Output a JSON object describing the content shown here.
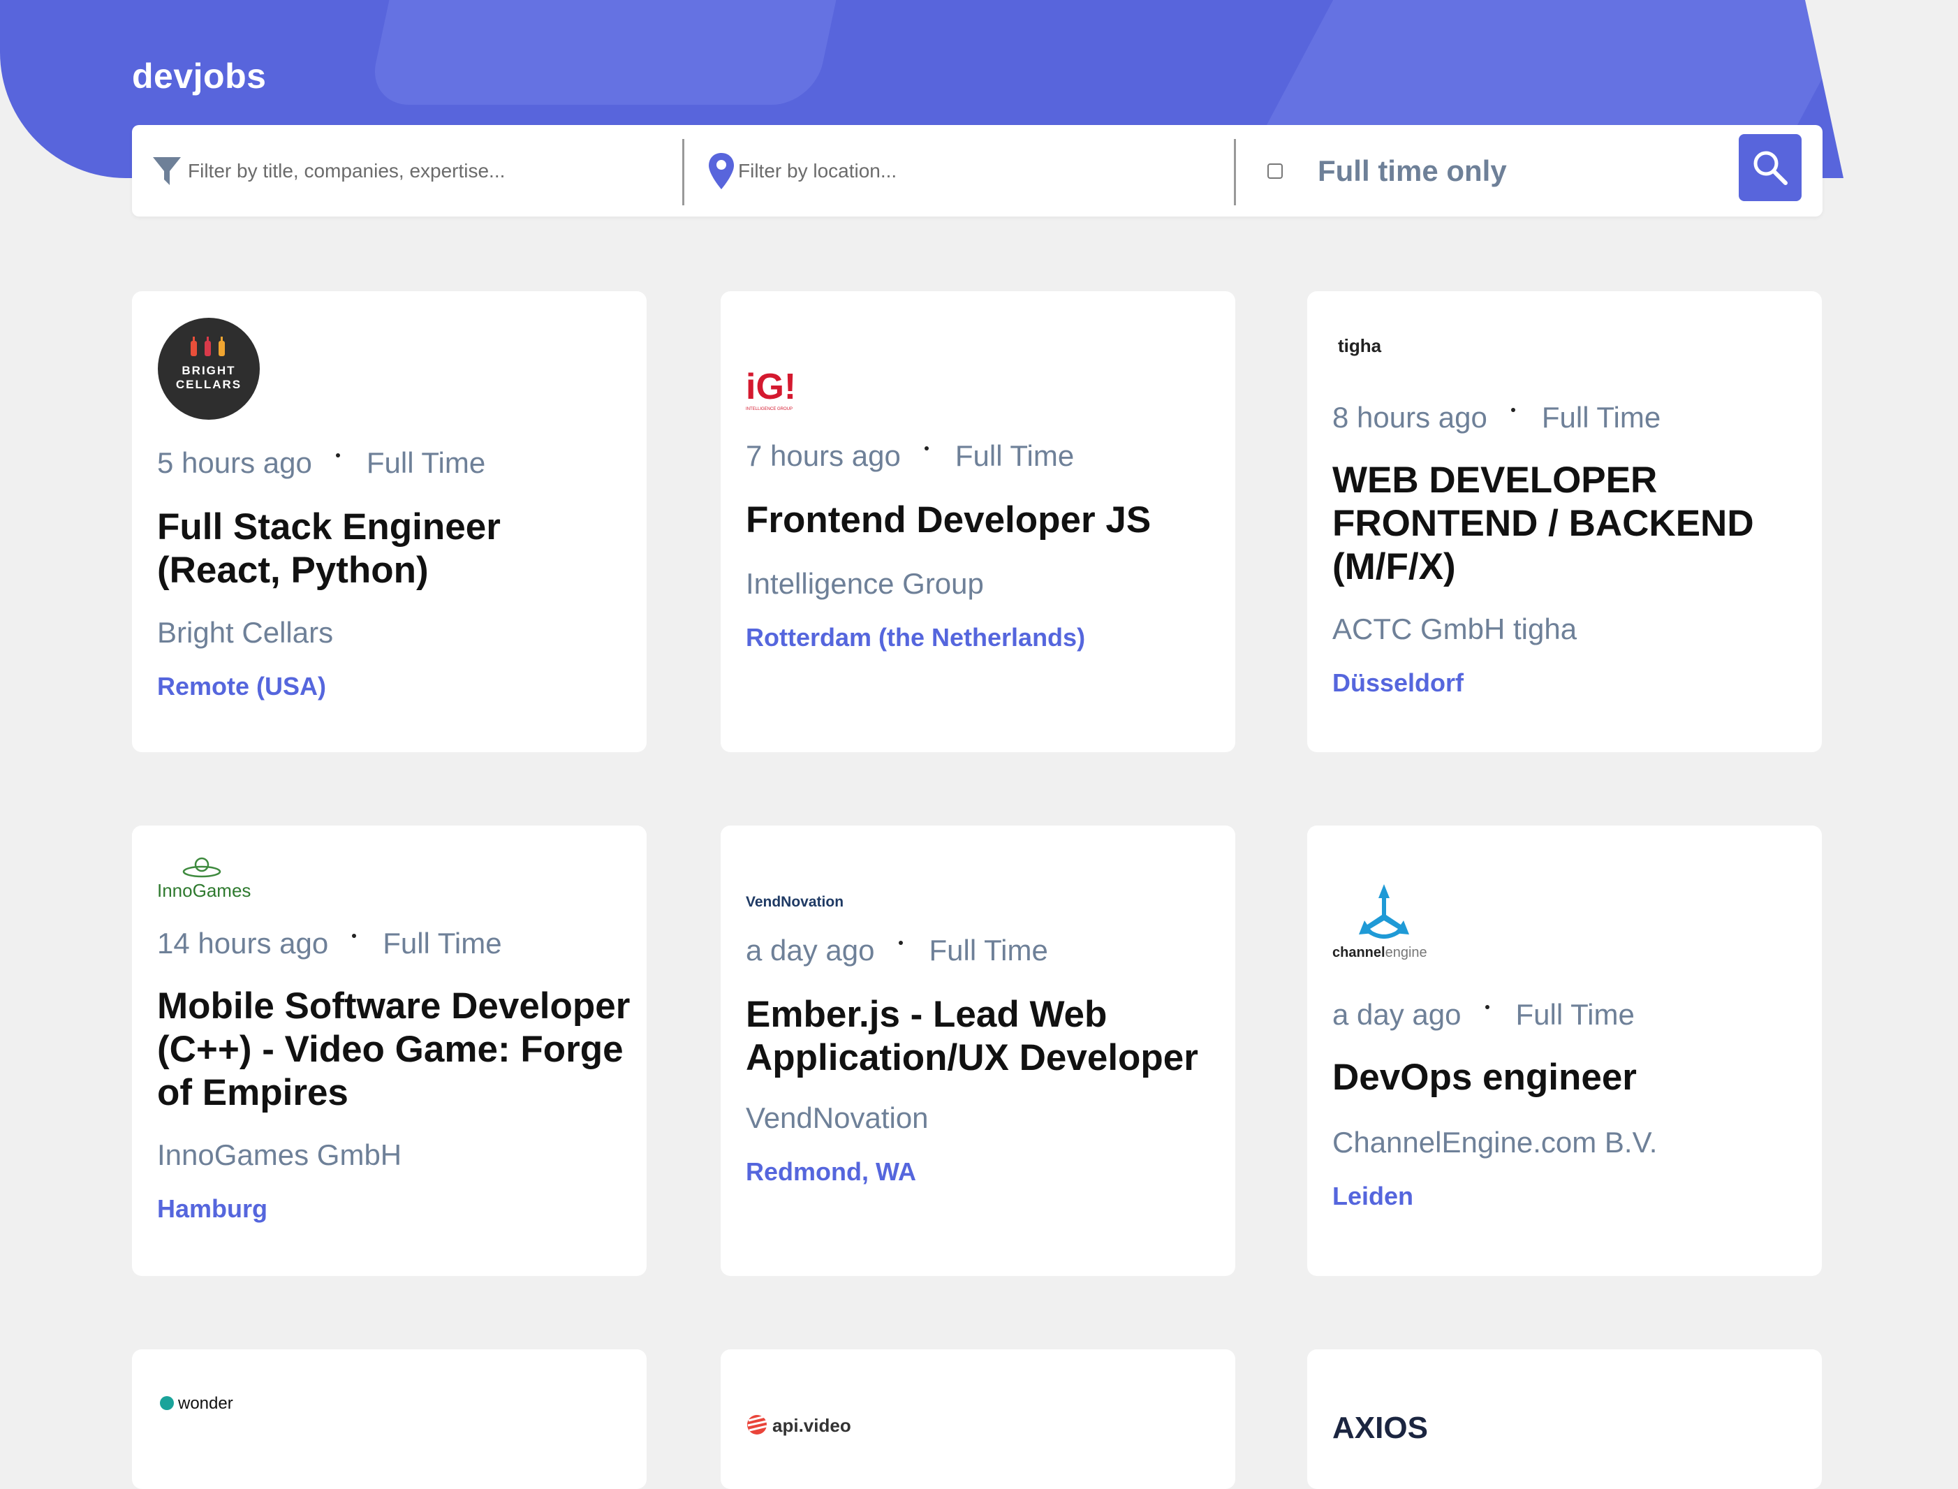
{
  "app": {
    "logo": "devjobs"
  },
  "filters": {
    "title_placeholder": "Filter by title, companies, expertise...",
    "location_placeholder": "Filter by location...",
    "fulltime_label": "Full time only",
    "fulltime_checked": false
  },
  "colors": {
    "brand": "#5865dc",
    "location_text": "#5566dd",
    "muted_text": "#6e8098",
    "background": "#f0f0f0"
  },
  "jobs": [
    {
      "posted": "5 hours ago",
      "contract": "Full Time",
      "title": "Full Stack Engineer (React, Python)",
      "company": "Bright Cellars",
      "location": "Remote (USA)",
      "logo_text_1": "BRIGHT",
      "logo_text_2": "CELLARS"
    },
    {
      "posted": "7 hours ago",
      "contract": "Full Time",
      "title": "Frontend Developer JS",
      "company": "Intelligence Group",
      "location": "Rotterdam (the Netherlands)",
      "logo_text_1": "iG!",
      "logo_text_2": "INTELLIGENCE GROUP"
    },
    {
      "posted": "8 hours ago",
      "contract": "Full Time",
      "title": "WEB DEVELOPER FRONTEND / BACKEND (M/F/X)",
      "company": "ACTC GmbH tigha",
      "location": "Düsseldorf",
      "logo_text_1": "tigha"
    },
    {
      "posted": "14 hours ago",
      "contract": "Full Time",
      "title": "Mobile Software Developer (C++) - Video Game: Forge of Empires",
      "company": "InnoGames GmbH",
      "location": "Hamburg",
      "logo_text_1": "InnoGames"
    },
    {
      "posted": "a day ago",
      "contract": "Full Time",
      "title": "Ember.js - Lead Web Application/UX Developer",
      "company": "VendNovation",
      "location": "Redmond, WA",
      "logo_text_1": "VendNovation"
    },
    {
      "posted": "a day ago",
      "contract": "Full Time",
      "title": "DevOps engineer",
      "company": "ChannelEngine.com B.V.",
      "location": "Leiden",
      "logo_text_1": "channel",
      "logo_text_2": "engine"
    }
  ],
  "partial_jobs": [
    {
      "logo_text_1": "wonder"
    },
    {
      "logo_text_1": "api.video"
    },
    {
      "logo_text_1": "AXIOS"
    }
  ]
}
